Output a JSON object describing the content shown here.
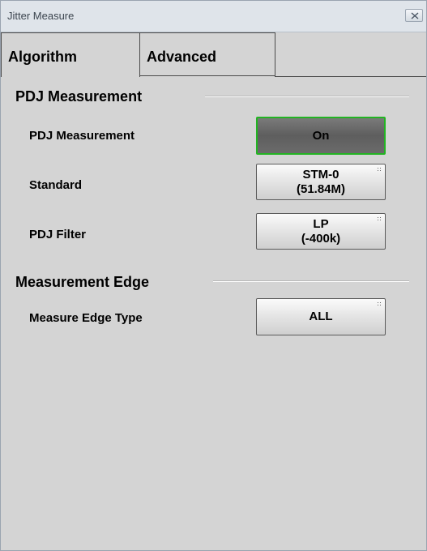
{
  "window": {
    "title": "Jitter Measure"
  },
  "tabs": [
    {
      "label": "Algorithm",
      "active": true
    },
    {
      "label": "Advanced",
      "active": false
    }
  ],
  "sections": {
    "pdj": {
      "header": "PDJ Measurement",
      "rows": {
        "measurement": {
          "label": "PDJ Measurement",
          "value": "On"
        },
        "standard": {
          "label": "Standard",
          "value_line1": "STM-0",
          "value_line2": "(51.84M)"
        },
        "filter": {
          "label": "PDJ Filter",
          "value_line1": "LP",
          "value_line2": "(-400k)"
        }
      }
    },
    "edge": {
      "header": "Measurement Edge",
      "rows": {
        "type": {
          "label": "Measure Edge Type",
          "value": "ALL"
        }
      }
    }
  },
  "colors": {
    "active_border": "#22b422",
    "panel_bg": "#d4d4d4",
    "titlebar_bg": "#dfe4ea"
  }
}
